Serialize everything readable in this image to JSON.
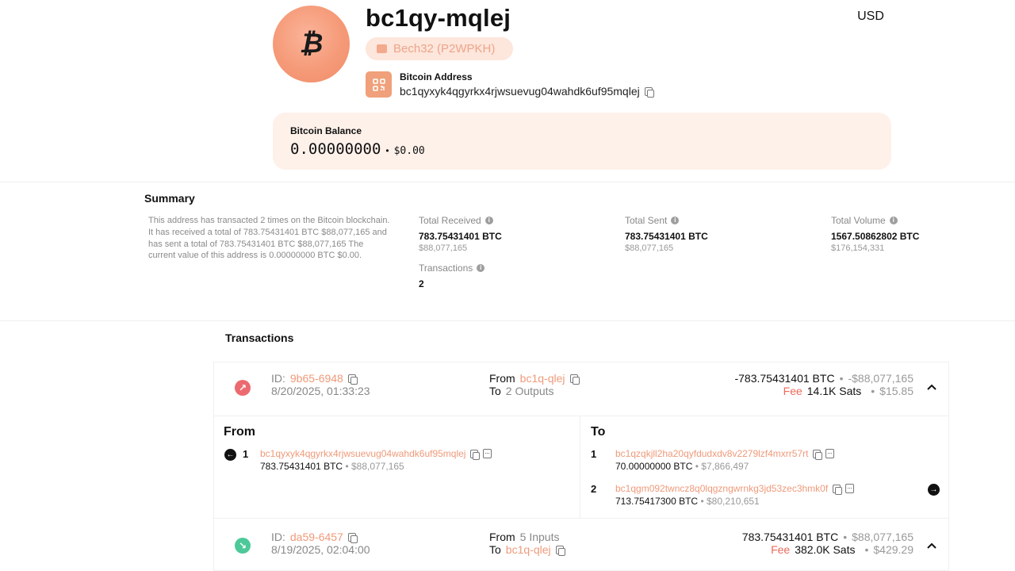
{
  "header": {
    "avatar_symbol": "₿",
    "address_short": "bc1qy-mqlej",
    "currency": "USD",
    "address_type": "Bech32 (P2WPKH)",
    "address_label": "Bitcoin Address",
    "address_full": "bc1qyxyk4qgyrkx4rjwsuevug04wahdk6uf95mqlej"
  },
  "balance": {
    "label": "Bitcoin Balance",
    "btc": "0.00000000",
    "separator": "•",
    "usd": "$0.00"
  },
  "summary": {
    "title": "Summary",
    "text": "This address has transacted 2 times on the Bitcoin blockchain. It has received a total of 783.75431401 BTC $88,077,165 and has sent a total of 783.75431401 BTC $88,077,165 The current value of this address is 0.00000000 BTC $0.00.",
    "total_received": {
      "label": "Total Received",
      "btc": "783.75431401 BTC",
      "usd": "$88,077,165"
    },
    "total_sent": {
      "label": "Total Sent",
      "btc": "783.75431401 BTC",
      "usd": "$88,077,165"
    },
    "total_volume": {
      "label": "Total Volume",
      "btc": "1567.50862802 BTC",
      "usd": "$176,154,331"
    },
    "transactions": {
      "label": "Transactions",
      "value": "2"
    }
  },
  "transactions": {
    "title": "Transactions",
    "items": [
      {
        "id_label": "ID:",
        "id": "9b65-6948",
        "date": "8/20/2025, 01:33:23",
        "from_label": "From",
        "from": "bc1q-qlej",
        "to_label": "To",
        "to": "2 Outputs",
        "amount_btc": "-783.75431401 BTC",
        "amount_usd": "-$88,077,165",
        "fee_label": "Fee",
        "fee_sats": "14.1K Sats",
        "fee_usd": "$15.85",
        "direction": "outgoing",
        "color": "#ec6a6f"
      },
      {
        "id_label": "ID:",
        "id": "da59-6457",
        "date": "8/19/2025, 02:04:00",
        "from_label": "From",
        "from": "5 Inputs",
        "to_label": "To",
        "to": "bc1q-qlej",
        "amount_btc": "783.75431401 BTC",
        "amount_usd": "$88,077,165",
        "fee_label": "Fee",
        "fee_sats": "382.0K Sats",
        "fee_usd": "$429.29",
        "direction": "incoming",
        "color": "#4dc999"
      }
    ],
    "detail": {
      "from_heading": "From",
      "to_heading": "To",
      "inputs": [
        {
          "index": "1",
          "address": "bc1qyxyk4qgyrkx4rjwsuevug04wahdk6uf95mqlej",
          "btc": "783.75431401 BTC",
          "usd": "$88,077,165"
        }
      ],
      "outputs": [
        {
          "index": "1",
          "address": "bc1qzqkjll2ha20qyfdudxdv8v2279lzf4mxrr57rt",
          "btc": "70.00000000 BTC",
          "usd": "$7,866,497"
        },
        {
          "index": "2",
          "address": "bc1qgm092twncz8q0lqgzngwrnkg3jd53zec3hmk0f",
          "btc": "713.75417300 BTC",
          "usd": "$80,210,651"
        }
      ]
    }
  },
  "colors": {
    "accent": "#ef9a7a",
    "negative": "#ec6a6f",
    "positive": "#4dc999",
    "balance_bg": "#fef1ea"
  }
}
